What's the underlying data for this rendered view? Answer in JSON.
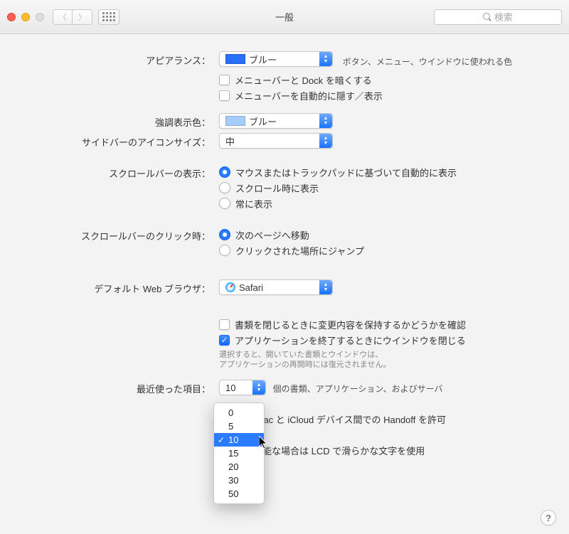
{
  "window": {
    "title": "一般"
  },
  "search": {
    "placeholder": "検索"
  },
  "appearance": {
    "label": "アピアランス：",
    "value": "ブルー",
    "desc": "ボタン、メニュー、ウインドウに使われる色"
  },
  "menubar_dark": {
    "label": "メニューバーと Dock を暗くする"
  },
  "menubar_autohide": {
    "label": "メニューバーを自動的に隠す／表示"
  },
  "highlight": {
    "label": "強調表示色：",
    "value": "ブルー"
  },
  "sidebar_icon": {
    "label": "サイドバーのアイコンサイズ：",
    "value": "中"
  },
  "scrollbar_show": {
    "label": "スクロールバーの表示：",
    "opt1": "マウスまたはトラックパッドに基づいて自動的に表示",
    "opt2": "スクロール時に表示",
    "opt3": "常に表示"
  },
  "scrollbar_click": {
    "label": "スクロールバーのクリック時：",
    "opt1": "次のページへ移動",
    "opt2": "クリックされた場所にジャンプ"
  },
  "browser": {
    "label": "デフォルト Web ブラウザ：",
    "value": "Safari"
  },
  "ask_keep_changes": {
    "label": "書類を閉じるときに変更内容を保持するかどうかを確認"
  },
  "close_windows": {
    "label": "アプリケーションを終了するときにウインドウを閉じる",
    "fine1": "選択すると、開いていた書類とウインドウは、",
    "fine2": "アプリケーションの再開時には復元されません。"
  },
  "recent": {
    "label": "最近使った項目：",
    "suffix": "個の書類、アプリケーション、およびサーバ",
    "options": [
      "0",
      "5",
      "10",
      "15",
      "20",
      "30",
      "50"
    ],
    "current": "10"
  },
  "handoff": {
    "label": "この Mac と iCloud デバイス間での Handoff を許可"
  },
  "lcd": {
    "label": "使用可能な場合は LCD で滑らかな文字を使用"
  },
  "help": "?"
}
